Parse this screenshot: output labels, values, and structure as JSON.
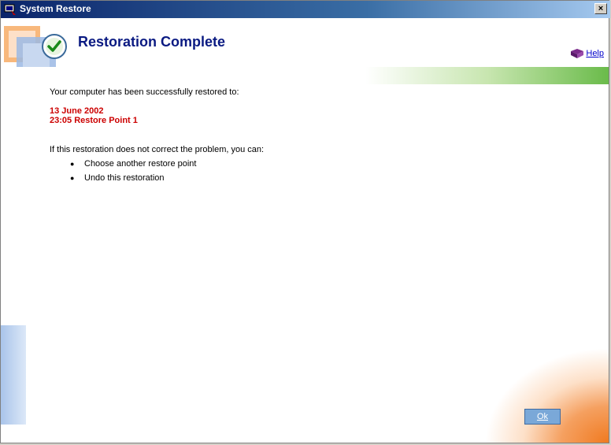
{
  "window": {
    "title": "System Restore",
    "close_label": "×"
  },
  "header": {
    "title": "Restoration Complete",
    "help_label": "Help"
  },
  "content": {
    "intro": "Your computer has been successfully restored to:",
    "restore_date": "13 June 2002",
    "restore_point": "23:05 Restore Point 1",
    "options_intro": "If this restoration does not correct the problem, you can:",
    "options": [
      "Choose another restore point",
      "Undo this restoration"
    ]
  },
  "footer": {
    "ok_label": "Ok"
  },
  "colors": {
    "title_blue": "#0a1a82",
    "accent_red": "#cc0000",
    "accent_green": "#6abb4a",
    "accent_orange": "#f07a20"
  }
}
